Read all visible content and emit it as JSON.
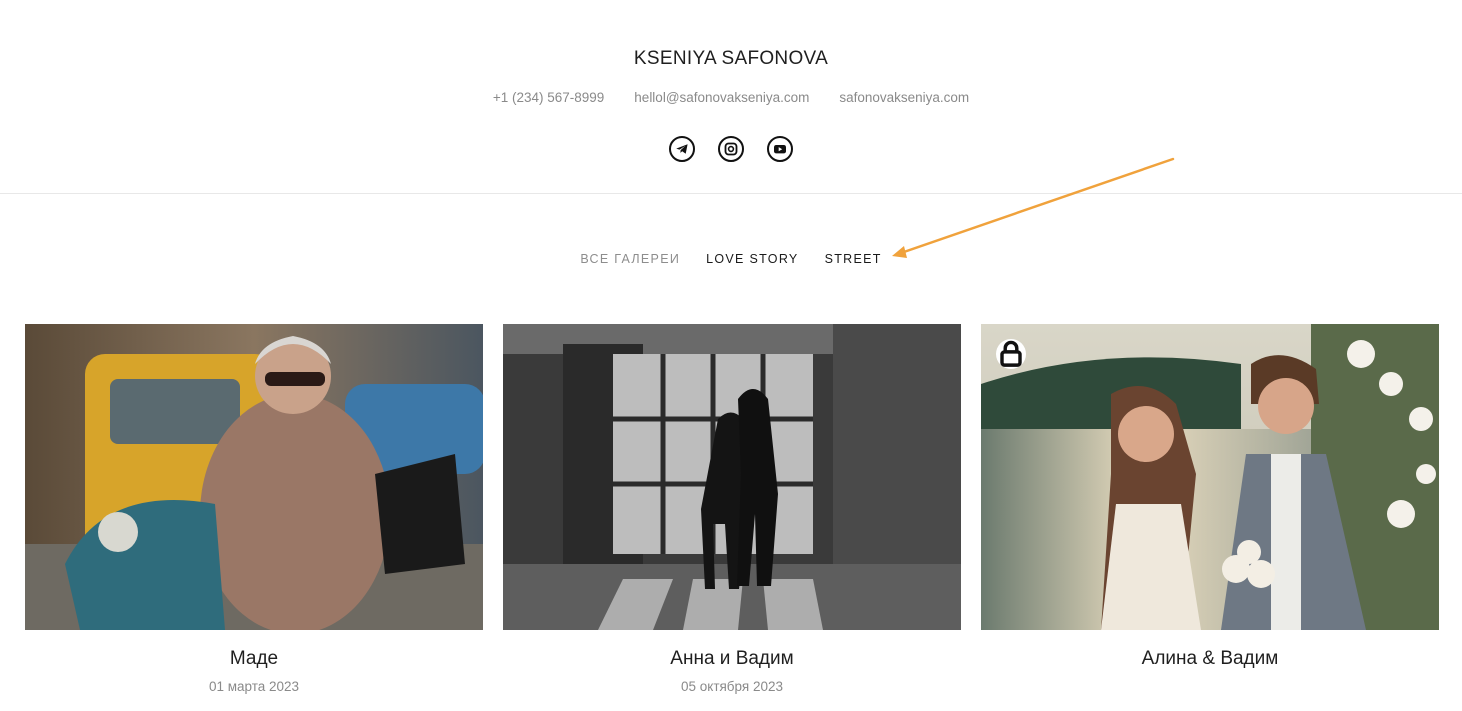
{
  "header": {
    "brand": "KSENIYA SAFONOVA",
    "phone": "+1 (234) 567-8999",
    "email": "hellol@safonovakseniya.com",
    "website": "safonovakseniya.com",
    "socials": [
      "telegram-icon",
      "instagram-icon",
      "youtube-icon"
    ]
  },
  "filters": {
    "all": "ВСЕ ГАЛЕРЕИ",
    "love_story": "LOVE STORY",
    "street": "STREET"
  },
  "annotation": {
    "color": "#f0a23c"
  },
  "galleries": [
    {
      "title": "Маде",
      "date": "01 марта 2023",
      "locked": false
    },
    {
      "title": "Анна и Вадим",
      "date": "05 октября 2023",
      "locked": false
    },
    {
      "title": "Алина & Вадим",
      "date": "",
      "locked": true
    }
  ]
}
